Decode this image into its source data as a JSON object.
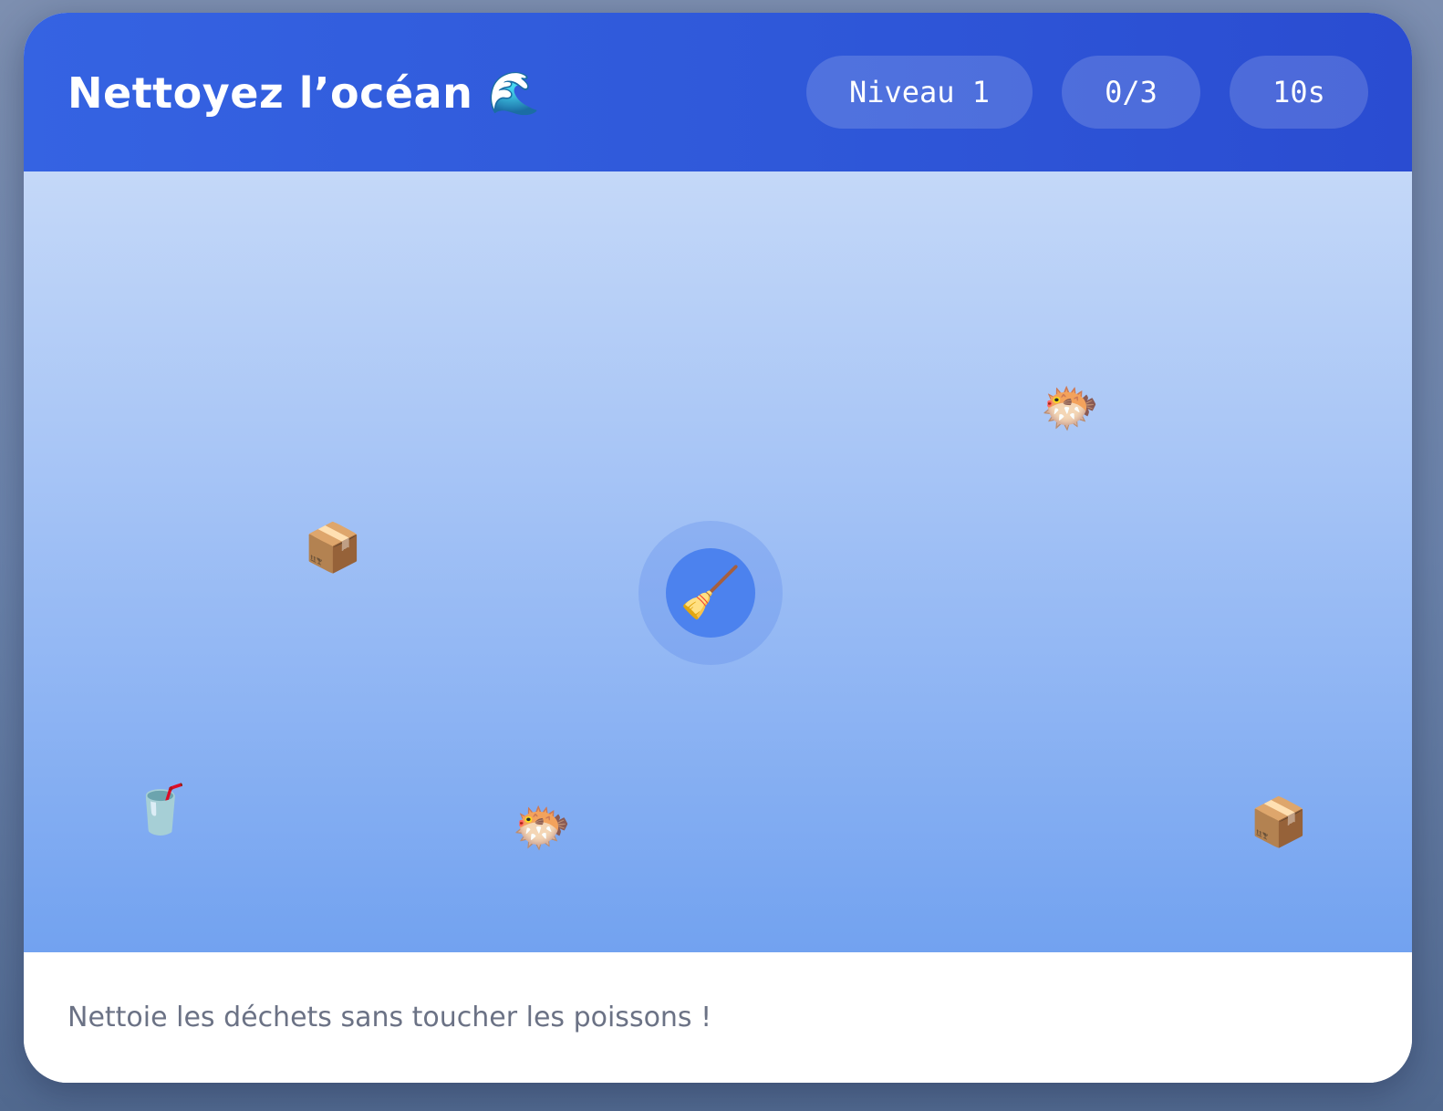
{
  "header": {
    "title": "Nettoyez l’océan",
    "title_icon": "🌊",
    "level": "Niveau 1",
    "score": "0/3",
    "timer": "10s"
  },
  "ocean": {
    "player_icon": "🧹",
    "pufferfish_icon": "🐡",
    "box_icon": "📦",
    "cup_icon": "🥤"
  },
  "footer": {
    "hint": "Nettoie les déchets sans toucher les poissons !"
  },
  "colors": {
    "header": "#2f58d9",
    "player": "#4c82ee",
    "ocean_top": "#c4d8f8",
    "ocean_bottom": "#72a2f0",
    "hint_text": "#6b7285"
  }
}
